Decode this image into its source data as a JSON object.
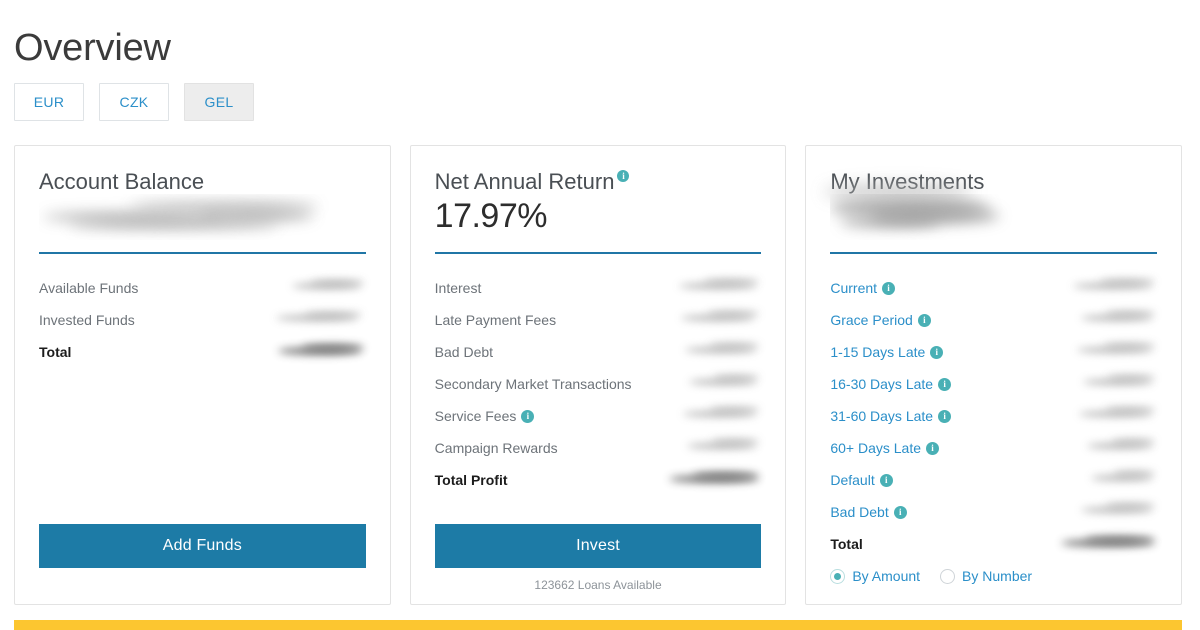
{
  "page": {
    "title": "Overview"
  },
  "currency_tabs": {
    "items": [
      {
        "label": "EUR",
        "active": false
      },
      {
        "label": "CZK",
        "active": false
      },
      {
        "label": "GEL",
        "active": true
      }
    ]
  },
  "colors": {
    "accent_blue": "#2b8fc9",
    "button_blue": "#1d7ba6",
    "rule_blue": "#2076a6",
    "info_teal": "#49b0b5",
    "bottom_bar_yellow": "#fcc630",
    "label_gray": "#6d7379",
    "card_border": "#e3e3e3"
  },
  "cards": {
    "account_balance": {
      "title": "Account Balance",
      "value_redacted": true,
      "rows": [
        {
          "label": "Available Funds",
          "value_redacted": true,
          "bold": false,
          "link": false,
          "info": false
        },
        {
          "label": "Invested Funds",
          "value_redacted": true,
          "bold": false,
          "link": false,
          "info": false
        },
        {
          "label": "Total",
          "value_redacted": true,
          "bold": true,
          "link": false,
          "info": false
        }
      ],
      "button": {
        "label": "Add Funds"
      }
    },
    "net_annual_return": {
      "title": "Net Annual Return",
      "title_info_icon": "info-icon",
      "value": "17.97%",
      "rows": [
        {
          "label": "Interest",
          "value_redacted": true,
          "bold": false,
          "link": false,
          "info": false
        },
        {
          "label": "Late Payment Fees",
          "value_redacted": true,
          "bold": false,
          "link": false,
          "info": false
        },
        {
          "label": "Bad Debt",
          "value_redacted": true,
          "bold": false,
          "link": false,
          "info": false
        },
        {
          "label": "Secondary Market Transactions",
          "value_redacted": true,
          "bold": false,
          "link": false,
          "info": false
        },
        {
          "label": "Service Fees",
          "value_redacted": true,
          "bold": false,
          "link": false,
          "info": true
        },
        {
          "label": "Campaign Rewards",
          "value_redacted": true,
          "bold": false,
          "link": false,
          "info": false
        },
        {
          "label": "Total Profit",
          "value_redacted": true,
          "bold": true,
          "link": false,
          "info": false
        }
      ],
      "button": {
        "label": "Invest"
      },
      "button_subtext": "123662 Loans Available"
    },
    "my_investments": {
      "title": "My Investments",
      "value_redacted": true,
      "rows": [
        {
          "label": "Current",
          "value_redacted": true,
          "bold": false,
          "link": true,
          "info": true
        },
        {
          "label": "Grace Period",
          "value_redacted": true,
          "bold": false,
          "link": true,
          "info": true
        },
        {
          "label": "1-15 Days Late",
          "value_redacted": true,
          "bold": false,
          "link": true,
          "info": true
        },
        {
          "label": "16-30 Days Late",
          "value_redacted": true,
          "bold": false,
          "link": true,
          "info": true
        },
        {
          "label": "31-60 Days Late",
          "value_redacted": true,
          "bold": false,
          "link": true,
          "info": true
        },
        {
          "label": "60+ Days Late",
          "value_redacted": true,
          "bold": false,
          "link": true,
          "info": true
        },
        {
          "label": "Default",
          "value_redacted": true,
          "bold": false,
          "link": true,
          "info": true
        },
        {
          "label": "Bad Debt",
          "value_redacted": true,
          "bold": false,
          "link": true,
          "info": true
        },
        {
          "label": "Total",
          "value_redacted": true,
          "bold": true,
          "link": false,
          "info": false
        }
      ],
      "radios": [
        {
          "label": "By Amount",
          "selected": true
        },
        {
          "label": "By Number",
          "selected": false
        }
      ]
    }
  },
  "info_icon_glyph": "i"
}
